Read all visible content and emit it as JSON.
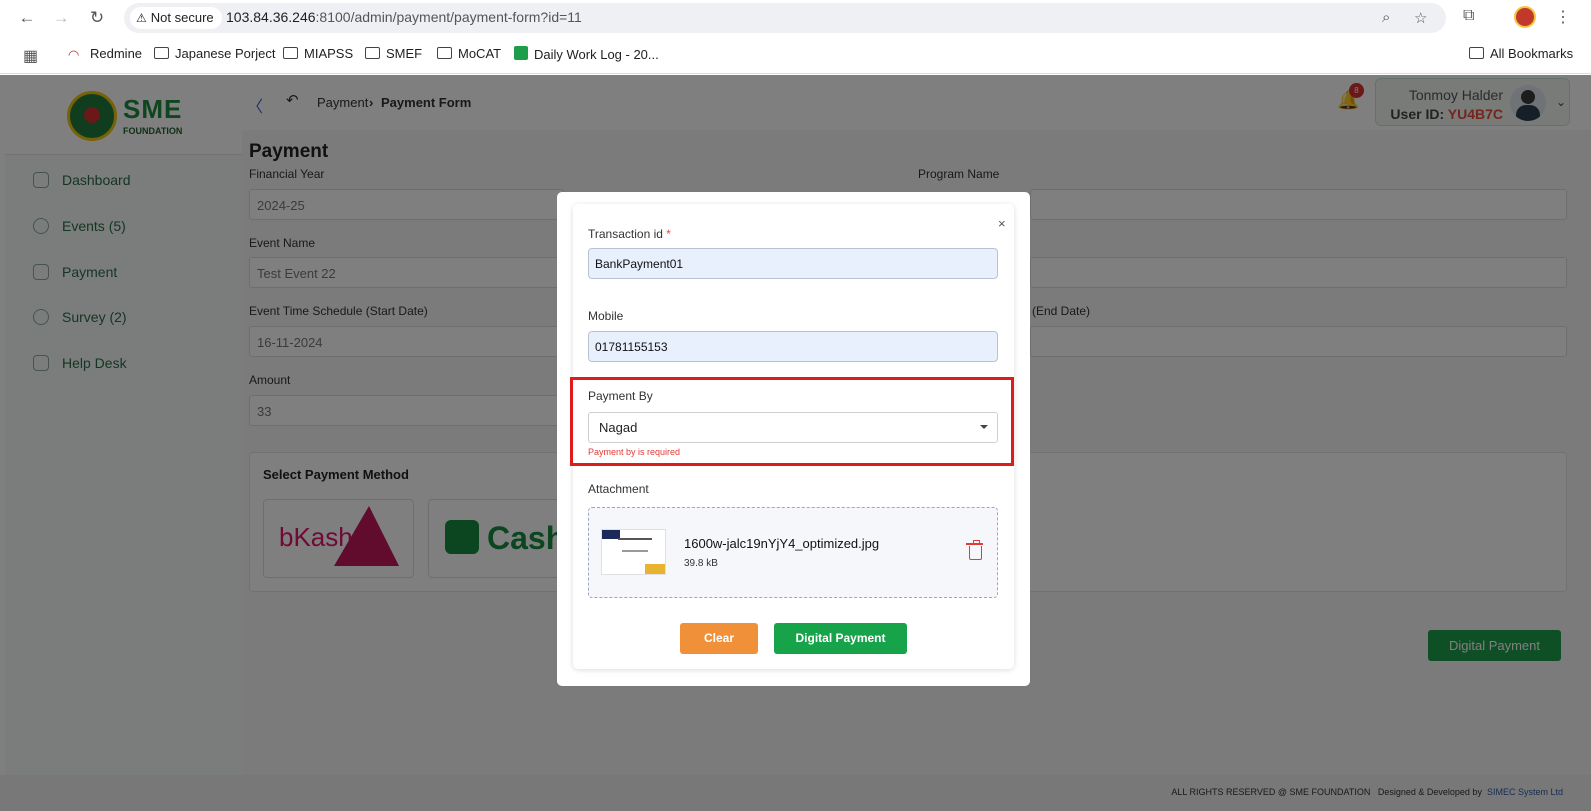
{
  "browser": {
    "security_label": "Not secure",
    "url_host": "103.84.36.246",
    "url_rest": ":8100/admin/payment/payment-form?id=11",
    "bookmarks": [
      "Redmine",
      "Japanese Porject",
      "MIAPSS",
      "SMEF",
      "MoCAT",
      "Daily Work Log - 20...",
      "All Bookmarks"
    ]
  },
  "app": {
    "logo_text": "SME",
    "logo_sub": "FOUNDATION",
    "sidebar": [
      "Dashboard",
      "Events (5)",
      "Payment",
      "Survey (2)",
      "Help Desk"
    ],
    "breadcrumb": [
      "Payment",
      "Payment Form"
    ],
    "notification_count": "8",
    "user_name": "Tonmoy Halder",
    "user_id_label": "User ID:",
    "user_id": "YU4B7C",
    "form_title": "Payment",
    "fields": {
      "financial_year_label": "Financial Year",
      "financial_year": "2024-25",
      "program_name_label": "Program Name",
      "event_name_label": "Event Name",
      "event_name": "Test Event 22",
      "start_date_label": "Event Time Schedule (Start Date)",
      "start_date": "16-11-2024",
      "end_date_label": "(End Date)",
      "amount_label": "Amount",
      "amount": "33"
    },
    "payment_method_title": "Select Payment Method",
    "payment_methods": [
      "bKash",
      "Cash"
    ],
    "bg_button": "Digital Payment",
    "footer_rights": "ALL RIGHTS RESERVED @ SME FOUNDATION",
    "footer_designed": "Designed & Developed by",
    "footer_dev": "SIMEC System Ltd"
  },
  "modal": {
    "close": "×",
    "transaction_label": "Transaction id",
    "required_mark": "*",
    "transaction_value": "BankPayment01",
    "mobile_label": "Mobile",
    "mobile_value": "01781155153",
    "payment_by_label": "Payment By",
    "payment_by_value": "Nagad",
    "payment_by_error": "Payment by is required",
    "attachment_label": "Attachment",
    "file_name": "1600w-jalc19nYjY4_optimized.jpg",
    "file_size": "39.8 kB",
    "clear_button": "Clear",
    "digital_payment_button": "Digital Payment"
  },
  "colors": {
    "brand_green": "#1e9e4a",
    "error_red": "#e53935",
    "clear_orange": "#f0913a",
    "highlight": "#e01b1b"
  }
}
